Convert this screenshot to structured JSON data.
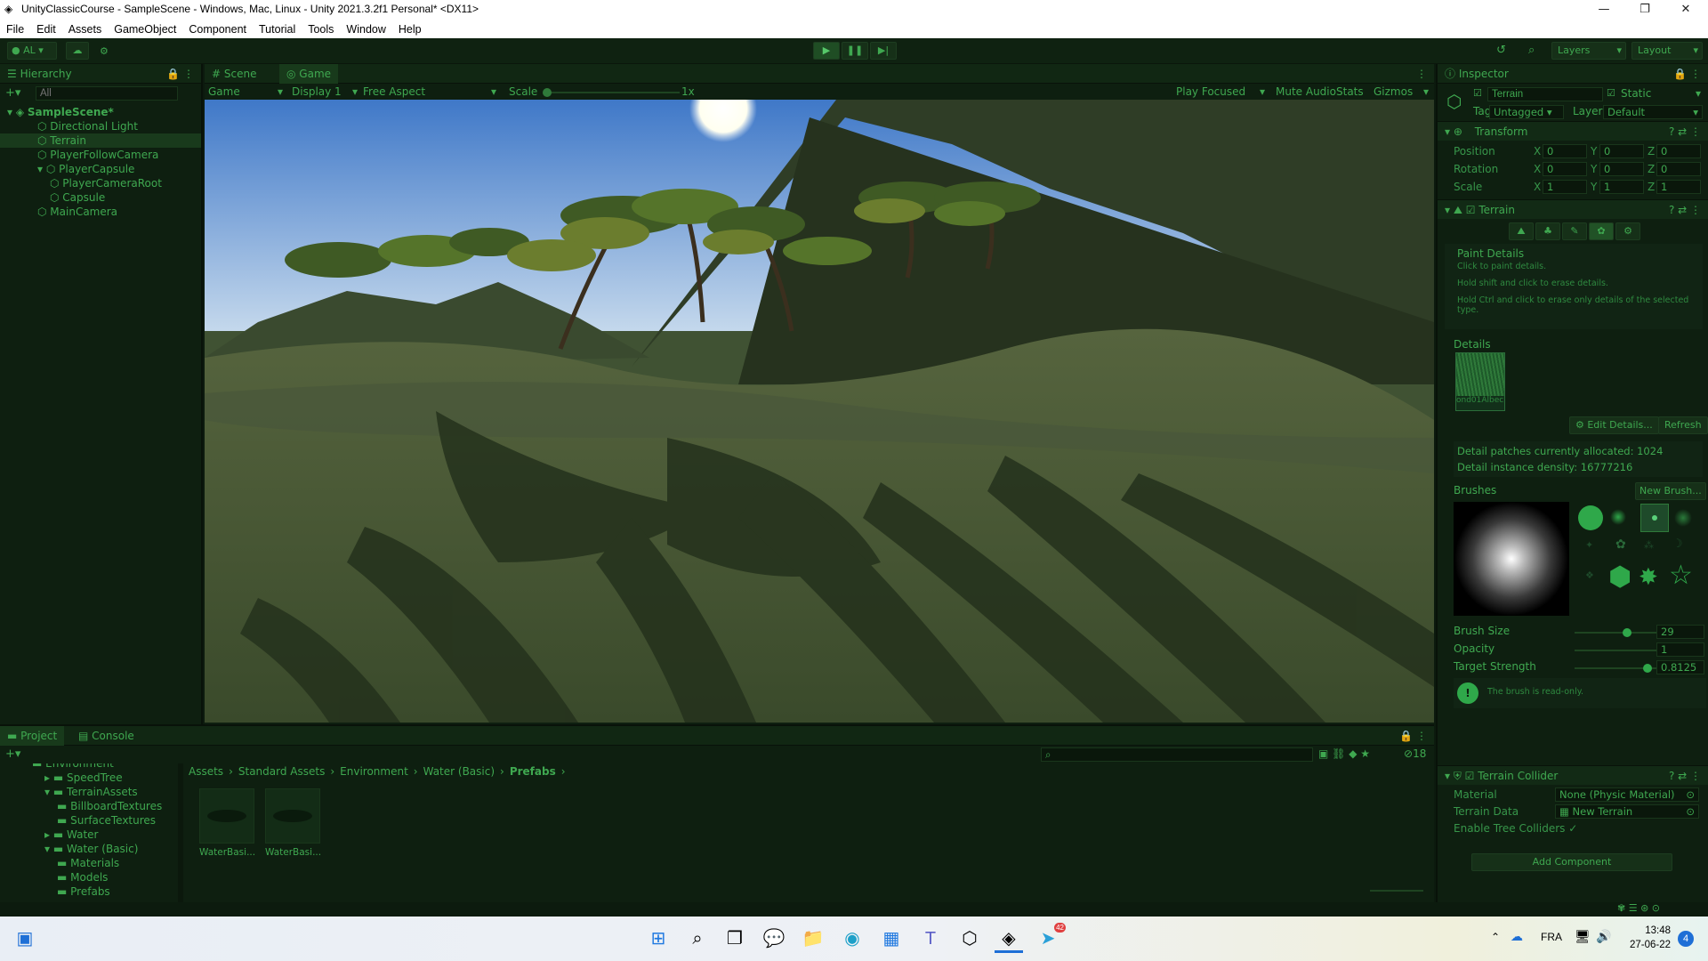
{
  "window": {
    "title": "UnityClassicCourse - SampleScene - Windows, Mac, Linux - Unity 2021.3.2f1 Personal* <DX11>",
    "minimize": "—",
    "maximize": "❐",
    "close": "✕"
  },
  "menu": [
    "File",
    "Edit",
    "Assets",
    "GameObject",
    "Component",
    "Tutorial",
    "Tools",
    "Window",
    "Help"
  ],
  "toolbar": {
    "account": "AL",
    "layers": "Layers",
    "layout": "Layout"
  },
  "hierarchy": {
    "tab": "Hierarchy",
    "search_placeholder": "All",
    "items": [
      {
        "label": "SampleScene*",
        "indent": 0
      },
      {
        "label": "Directional Light",
        "indent": 1
      },
      {
        "label": "Terrain",
        "indent": 1
      },
      {
        "label": "PlayerFollowCamera",
        "indent": 1
      },
      {
        "label": "PlayerCapsule",
        "indent": 1
      },
      {
        "label": "PlayerCameraRoot",
        "indent": 2
      },
      {
        "label": "Capsule",
        "indent": 2
      },
      {
        "label": "MainCamera",
        "indent": 1
      }
    ]
  },
  "view": {
    "tab_scene": "Scene",
    "tab_game": "Game",
    "game_dropdown": "Game",
    "display": "Display 1",
    "aspect": "Free Aspect",
    "scale_label": "Scale",
    "scale_value": "1x",
    "play_focused": "Play Focused",
    "mute_audio": "Mute Audio",
    "stats": "Stats",
    "gizmos": "Gizmos"
  },
  "inspector": {
    "tab": "Inspector",
    "object_name": "Terrain",
    "static_label": "Static",
    "tag_label": "Tag",
    "tag_value": "Untagged",
    "layer_label": "Layer",
    "layer_value": "Default",
    "transform": {
      "title": "Transform",
      "rows": [
        {
          "label": "Position",
          "x": "0",
          "y": "0",
          "z": "0"
        },
        {
          "label": "Rotation",
          "x": "0",
          "y": "0",
          "z": "0"
        },
        {
          "label": "Scale",
          "x": "1",
          "y": "1",
          "z": "1"
        }
      ],
      "axis_x": "X",
      "axis_y": "Y",
      "axis_z": "Z"
    },
    "terrain": {
      "title": "Terrain",
      "paint_title": "Paint Details",
      "hint1": "Click to paint details.",
      "hint2": "Hold shift and click to erase details.",
      "hint3": "Hold Ctrl and click to erase only details of the selected type.",
      "details_label": "Details",
      "detail_thumb_label": "ond01Albec",
      "edit_details": "Edit Details...",
      "refresh": "Refresh",
      "allocated": "Detail patches currently allocated: 1024",
      "density": "Detail instance density: 16777216",
      "brushes_label": "Brushes",
      "new_brush": "New Brush...",
      "brush_size_label": "Brush Size",
      "brush_size_value": "29",
      "brush_size_frac": 0.58,
      "opacity_label": "Opacity",
      "opacity_value": "1",
      "opacity_frac": 1.0,
      "strength_label": "Target Strength",
      "strength_value": "0.8125",
      "strength_frac": 0.8125,
      "readonly": "The brush is read-only."
    },
    "collider": {
      "title": "Terrain Collider",
      "material_label": "Material",
      "material_value": "None (Physic Material)",
      "data_label": "Terrain Data",
      "data_value": "New Terrain",
      "trees_label": "Enable Tree Colliders"
    },
    "add_component": "Add Component"
  },
  "project": {
    "tab_project": "Project",
    "tab_console": "Console",
    "tree": [
      {
        "label": "Environment",
        "indent": 0
      },
      {
        "label": "SpeedTree",
        "indent": 1
      },
      {
        "label": "TerrainAssets",
        "indent": 1
      },
      {
        "label": "BillboardTextures",
        "indent": 2
      },
      {
        "label": "SurfaceTextures",
        "indent": 2
      },
      {
        "label": "Water",
        "indent": 1
      },
      {
        "label": "Water (Basic)",
        "indent": 1
      },
      {
        "label": "Materials",
        "indent": 2
      },
      {
        "label": "Models",
        "indent": 2
      },
      {
        "label": "Prefabs",
        "indent": 2
      }
    ],
    "breadcrumb": [
      "Assets",
      "Standard Assets",
      "Environment",
      "Water (Basic)",
      "Prefabs"
    ],
    "assets": [
      "WaterBasi...",
      "WaterBasi..."
    ],
    "hidden_count": "18"
  },
  "taskbar": {
    "lang": "FRA",
    "time": "13:48",
    "date": "27-06-22",
    "notif": "4",
    "telegram_badge": "42"
  }
}
